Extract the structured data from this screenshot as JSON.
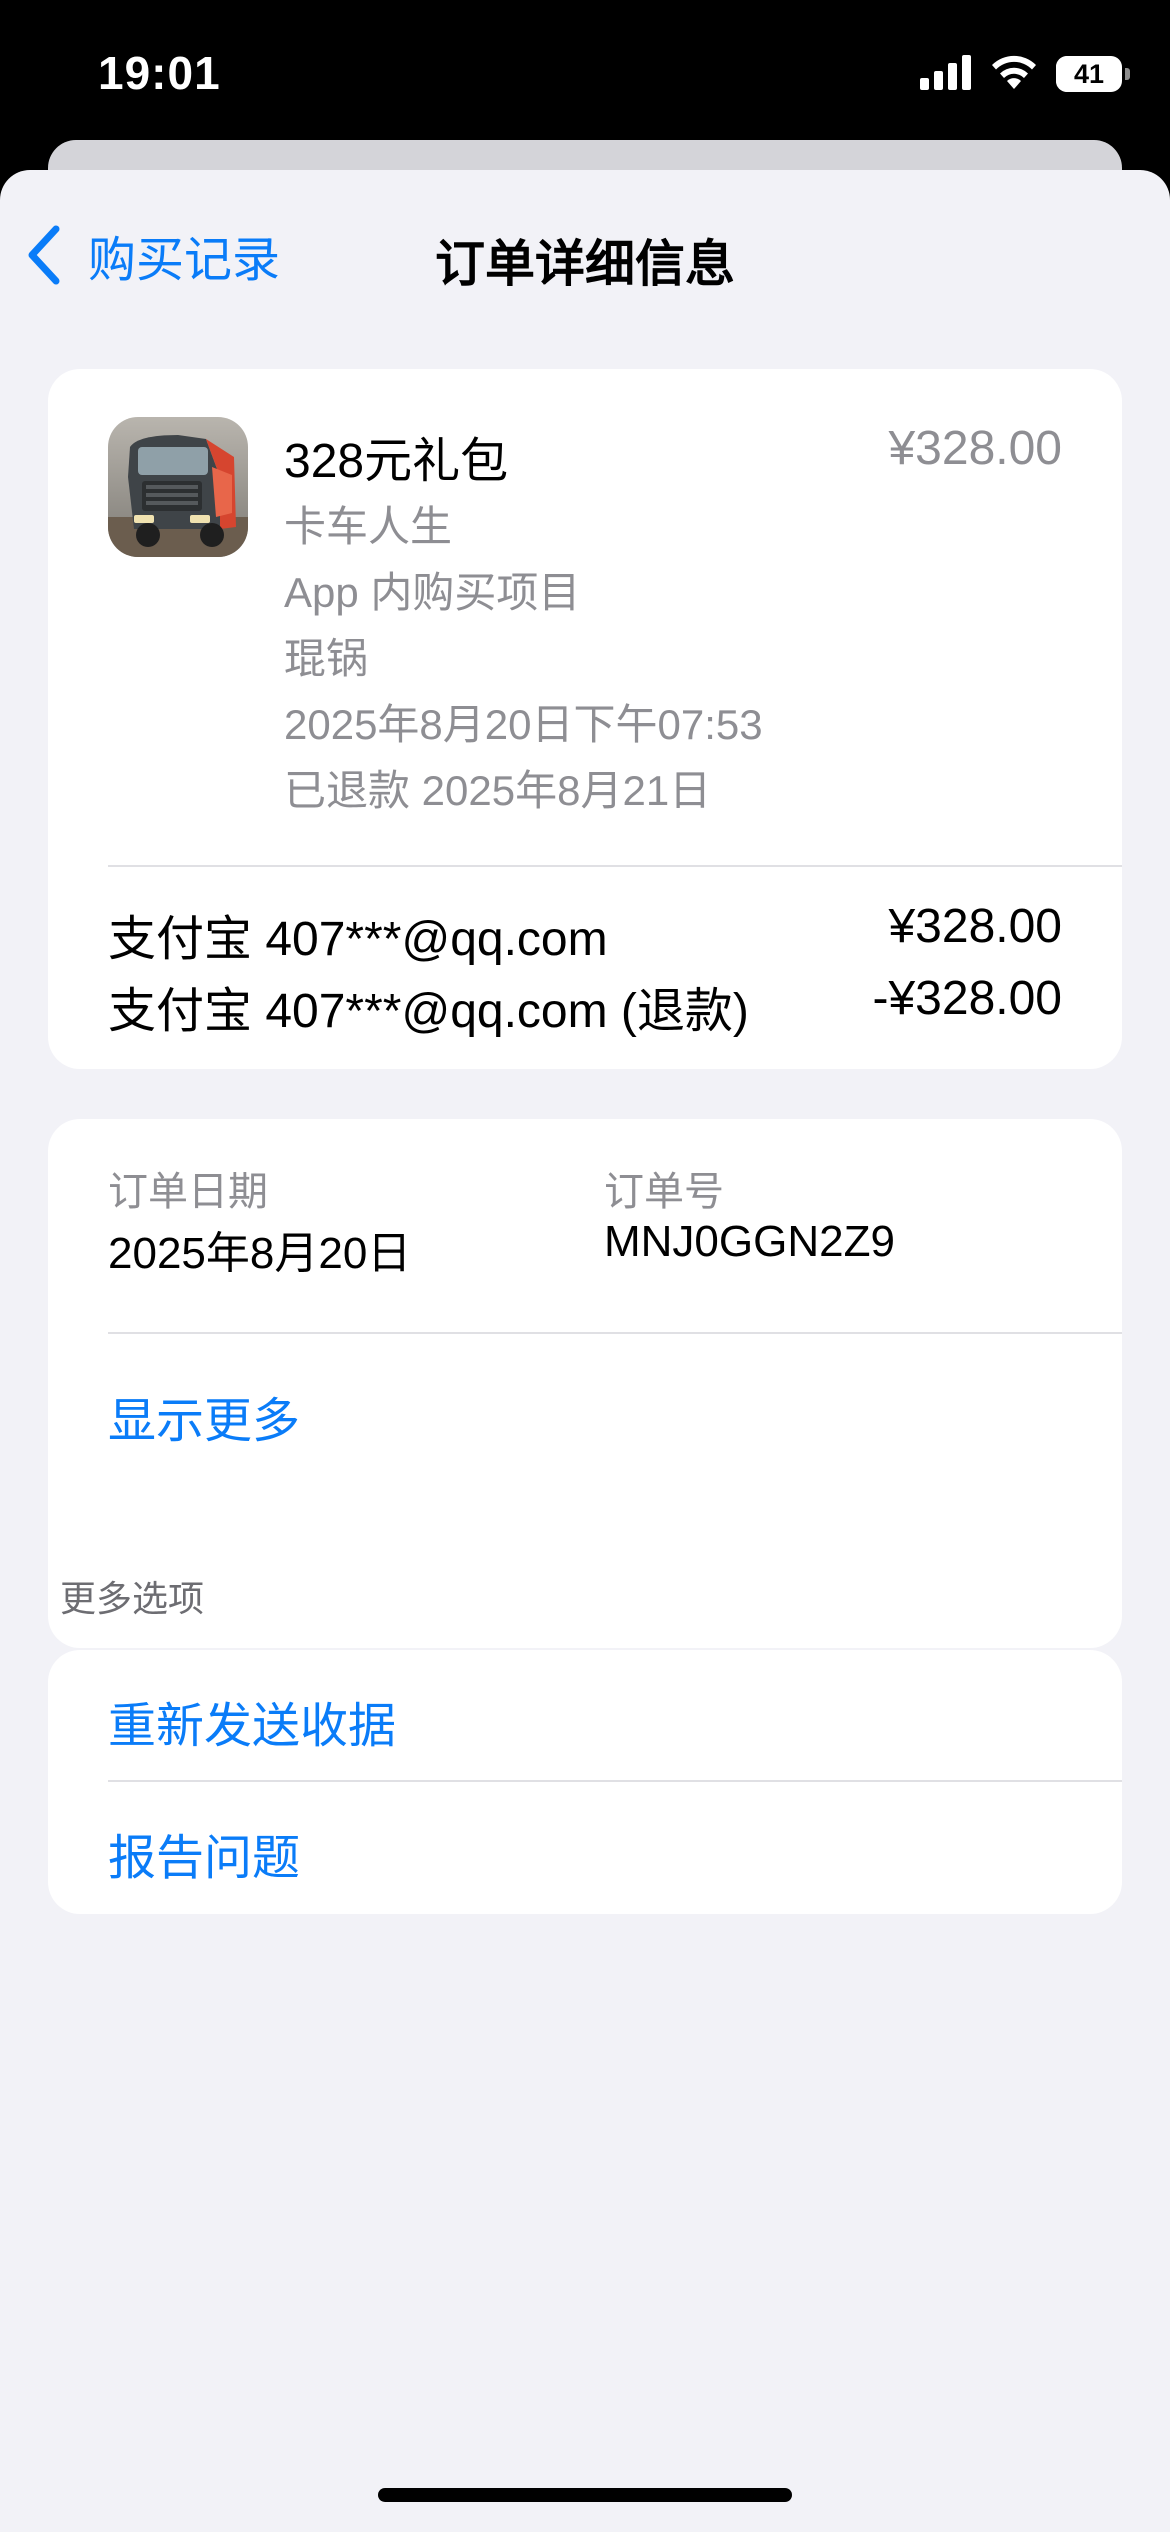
{
  "status_bar": {
    "time": "19:01",
    "battery_level": "41"
  },
  "nav": {
    "back_label": "购买记录",
    "title": "订单详细信息"
  },
  "purchase": {
    "item_name": "328元礼包",
    "price": "¥328.00",
    "app_name": "卡车人生",
    "item_type": "App 内购买项目",
    "device": "琨锅",
    "purchase_time": "2025年8月20日下午07:53",
    "refund_status": "已退款 2025年8月21日",
    "payments": [
      {
        "method": "支付宝 407***@qq.com",
        "amount": "¥328.00"
      },
      {
        "method": "支付宝 407***@qq.com (退款)",
        "amount": "-¥328.00"
      }
    ]
  },
  "order_info": {
    "date_label": "订单日期",
    "date_value": "2025年8月20日",
    "number_label": "订单号",
    "number_value": "MNJ0GGN2Z9",
    "show_more": "显示更多"
  },
  "more_options": {
    "header": "更多选项",
    "items": [
      {
        "label": "重新发送收据"
      },
      {
        "label": "报告问题"
      }
    ]
  },
  "colors": {
    "accent": "#0a7cf8",
    "secondary_text": "#8e8e93",
    "background": "#f2f2f7"
  },
  "icons": [
    "cellular-signal-icon",
    "wifi-icon",
    "battery-icon",
    "chevron-left-icon",
    "app-icon-truck-life"
  ]
}
